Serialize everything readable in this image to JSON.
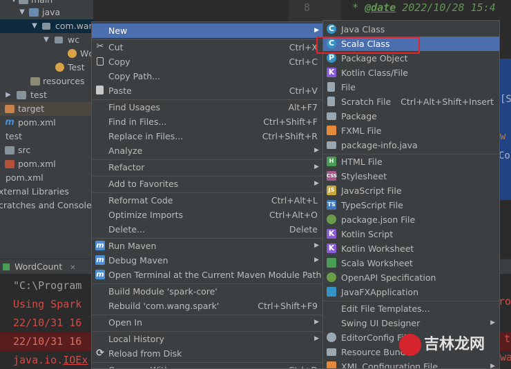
{
  "project_tree": {
    "rows": [
      {
        "label": "main",
        "icon": "folder-icon"
      },
      {
        "label": "java",
        "icon": "source-folder-icon"
      },
      {
        "label": "com.wan",
        "icon": "package-icon"
      },
      {
        "label": "wc",
        "icon": "package-icon"
      },
      {
        "label": "Wc",
        "icon": "scala-object-icon"
      },
      {
        "label": "Test",
        "icon": "scala-object-icon"
      },
      {
        "label": "resources",
        "icon": "resources-folder-icon"
      },
      {
        "label": "test",
        "icon": "folder-icon"
      },
      {
        "label": "target",
        "icon": "target-folder-icon"
      },
      {
        "label": "pom.xml",
        "icon": "maven-icon"
      },
      {
        "label": "test",
        "icon": "module-icon"
      },
      {
        "label": "src",
        "icon": "folder-icon"
      },
      {
        "label": "pom.xml",
        "icon": "maven-icon"
      },
      {
        "label": "pom.xml",
        "icon": "maven-icon"
      },
      {
        "label": "xternal Libraries",
        "icon": "libraries-icon"
      },
      {
        "label": "cratches and Consoles",
        "icon": "scratches-icon"
      }
    ]
  },
  "editor": {
    "line_number": "8",
    "code_star": "*",
    "code_tag": "@date",
    "code_text": "2022/10/28 15:4",
    "frag1": "[S",
    "frag2": "w",
    "frag3": "Co"
  },
  "run_panel": {
    "tab_label": "WordCount",
    "close_glyph": "✕",
    "lines": [
      "\"C:\\Program",
      "Using Spark",
      "22/10/31 16",
      "22/10/31 16",
      "java.io.",
      "IOEx"
    ],
    "right_frags": [
      "ro",
      "t",
      "wa"
    ]
  },
  "context_menu": {
    "items": [
      {
        "label": "New",
        "submenu": true,
        "selected": true
      },
      {
        "label": "Cut",
        "shortcut": "Ctrl+X",
        "icon": "scissors-icon"
      },
      {
        "label": "Copy",
        "shortcut": "Ctrl+C",
        "icon": "copy-icon"
      },
      {
        "label": "Copy Path...",
        "shortcut": ""
      },
      {
        "label": "Paste",
        "shortcut": "Ctrl+V",
        "icon": "paste-icon"
      },
      {
        "label": "Find Usages",
        "shortcut": "Alt+F7"
      },
      {
        "label": "Find in Files...",
        "shortcut": "Ctrl+Shift+F"
      },
      {
        "label": "Replace in Files...",
        "shortcut": "Ctrl+Shift+R"
      },
      {
        "label": "Analyze",
        "submenu": true
      },
      {
        "label": "Refactor",
        "submenu": true
      },
      {
        "label": "Add to Favorites",
        "submenu": true
      },
      {
        "label": "Reformat Code",
        "shortcut": "Ctrl+Alt+L"
      },
      {
        "label": "Optimize Imports",
        "shortcut": "Ctrl+Alt+O"
      },
      {
        "label": "Delete...",
        "shortcut": "Delete"
      },
      {
        "label": "Run Maven",
        "submenu": true,
        "icon": "maven-run-icon"
      },
      {
        "label": "Debug Maven",
        "submenu": true,
        "icon": "maven-debug-icon"
      },
      {
        "label": "Open Terminal at the Current Maven Module Path",
        "icon": "terminal-icon"
      },
      {
        "label": "Build Module 'spark-core'",
        "shortcut": ""
      },
      {
        "label": "Rebuild 'com.wang.spark'",
        "shortcut": "Ctrl+Shift+F9"
      },
      {
        "label": "Open In",
        "submenu": true
      },
      {
        "label": "Local History",
        "submenu": true
      },
      {
        "label": "Reload from Disk",
        "icon": "reload-icon"
      },
      {
        "label": "Compare With...",
        "shortcut": "Ctrl+D"
      }
    ]
  },
  "new_submenu": {
    "items": [
      {
        "label": "Java Class",
        "icon": "java-class-icon",
        "color": "#3592c4"
      },
      {
        "label": "Scala Class",
        "icon": "scala-class-icon",
        "color": "#d8473a",
        "selected": true
      },
      {
        "label": "Package Object",
        "icon": "package-object-icon",
        "color": "#3592c4"
      },
      {
        "label": "Kotlin Class/File",
        "icon": "kotlin-file-icon",
        "color": "#8b5ad6"
      },
      {
        "label": "File",
        "icon": "file-icon",
        "color": "#9aa7b0"
      },
      {
        "label": "Scratch File",
        "shortcut": "Ctrl+Alt+Shift+Insert",
        "icon": "scratch-file-icon",
        "color": "#9aa7b0"
      },
      {
        "label": "Package",
        "icon": "package-icon",
        "color": "#9aa7b0"
      },
      {
        "label": "FXML File",
        "icon": "fxml-file-icon",
        "color": "#e5883a"
      },
      {
        "label": "package-info.java",
        "icon": "package-info-icon",
        "color": "#9aa7b0"
      },
      {
        "label": "HTML File",
        "icon": "html-file-icon",
        "color": "#499c54"
      },
      {
        "label": "Stylesheet",
        "icon": "css-file-icon",
        "color": "#a7588d"
      },
      {
        "label": "JavaScript File",
        "icon": "javascript-file-icon",
        "color": "#c7a63c"
      },
      {
        "label": "TypeScript File",
        "icon": "typescript-file-icon",
        "color": "#3f7ac1"
      },
      {
        "label": "package.json File",
        "icon": "npm-icon",
        "color": "#6a9c4a"
      },
      {
        "label": "Kotlin Script",
        "icon": "kotlin-script-icon",
        "color": "#8b5ad6"
      },
      {
        "label": "Kotlin Worksheet",
        "icon": "kotlin-worksheet-icon",
        "color": "#8b5ad6"
      },
      {
        "label": "Scala Worksheet",
        "icon": "scala-worksheet-icon",
        "color": "#499c54"
      },
      {
        "label": "OpenAPI Specification",
        "icon": "openapi-icon",
        "color": "#6a9c4a"
      },
      {
        "label": "JavaFXApplication",
        "icon": "javafx-icon",
        "color": "#3592c4"
      },
      {
        "label": "Edit File Templates...",
        "icon": ""
      },
      {
        "label": "Swing UI Designer",
        "submenu": true
      },
      {
        "label": "EditorConfig File",
        "icon": "editorconfig-icon",
        "color": "#9aa7b0"
      },
      {
        "label": "Resource Bundle",
        "icon": "resource-bundle-icon",
        "color": "#9aa7b0"
      },
      {
        "label": "XML Configuration File",
        "submenu": true,
        "icon": "xml-config-icon",
        "color": "#e5883a"
      }
    ]
  },
  "watermark": {
    "text": "吉林龙网"
  }
}
